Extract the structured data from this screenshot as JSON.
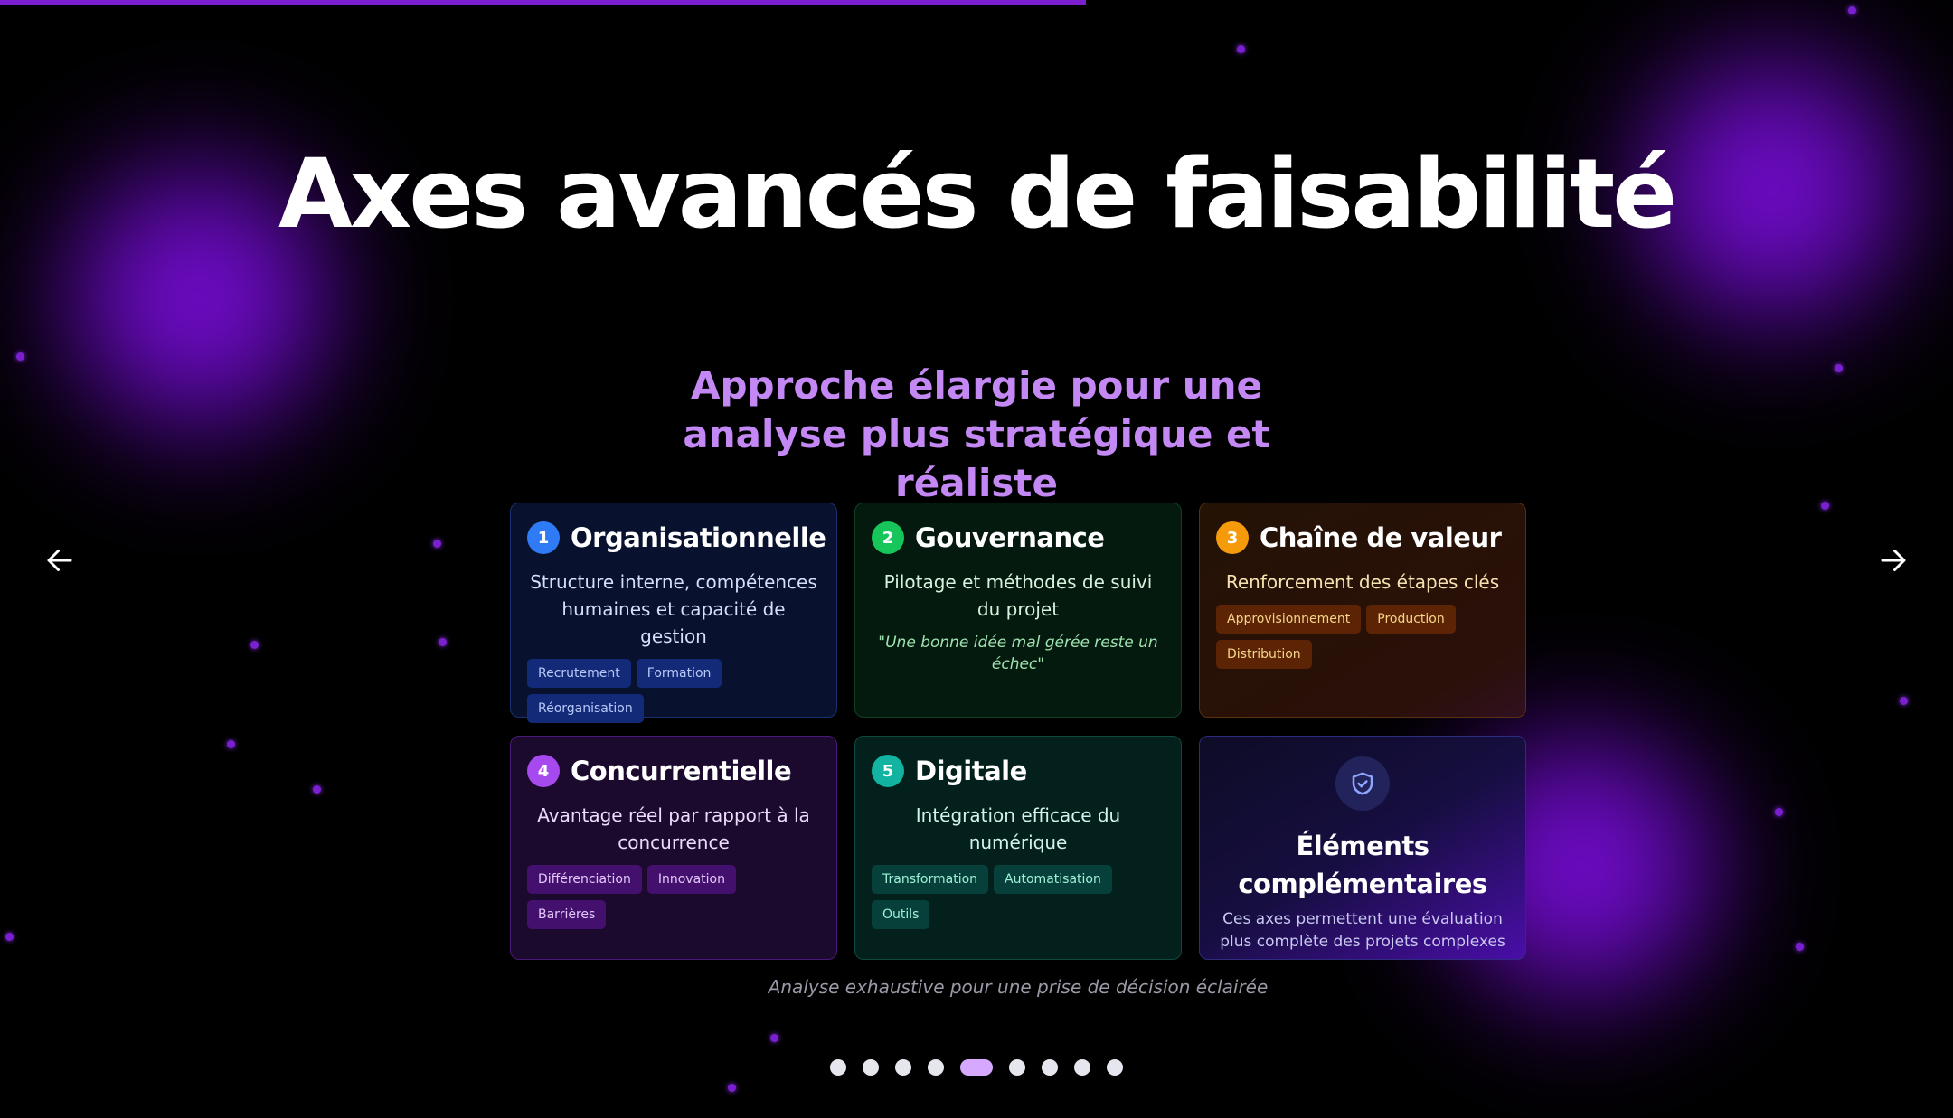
{
  "progress_percent": 55.6,
  "title": "Axes avancés de faisabilité",
  "subtitle": "Approche élargie pour une analyse plus stratégique et réaliste",
  "cards": [
    {
      "number": "1",
      "title": "Organisationnelle",
      "description": "Structure interne, compétences humaines et capacité de gestion",
      "tags": [
        "Recrutement",
        "Formation",
        "Réorganisation"
      ],
      "accent": "#2f7bf5"
    },
    {
      "number": "2",
      "title": "Gouvernance",
      "description": "Pilotage et méthodes de suivi du projet",
      "quote": "\"Une bonne idée mal gérée reste un échec\"",
      "accent": "#16c65a"
    },
    {
      "number": "3",
      "title": "Chaîne de valeur",
      "description": "Renforcement des étapes clés",
      "tags": [
        "Approvisionnement",
        "Production",
        "Distribution"
      ],
      "accent": "#f59a0a"
    },
    {
      "number": "4",
      "title": "Concurrentielle",
      "description": "Avantage réel par rapport à la concurrence",
      "tags": [
        "Différenciation",
        "Innovation",
        "Barrières"
      ],
      "accent": "#a64af0"
    },
    {
      "number": "5",
      "title": "Digitale",
      "description": "Intégration efficace du numérique",
      "tags": [
        "Transformation",
        "Automatisation",
        "Outils"
      ],
      "accent": "#12b3a0"
    }
  ],
  "complement": {
    "icon": "shield-check-icon",
    "title": "Éléments complémentaires",
    "description": "Ces axes permettent une évaluation plus complète des projets complexes"
  },
  "footer": "Analyse exhaustive pour une prise de décision éclairée",
  "pagination": {
    "total": 9,
    "current": 5
  },
  "nav": {
    "prev_icon": "arrow-left-icon",
    "next_icon": "arrow-right-icon"
  }
}
